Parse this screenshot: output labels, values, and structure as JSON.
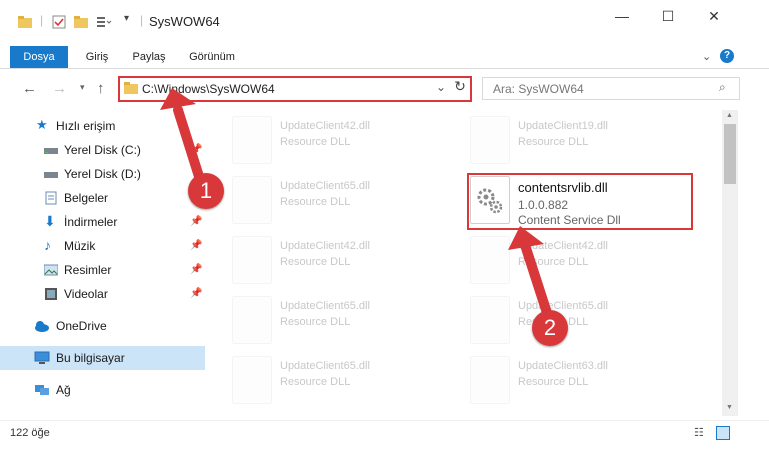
{
  "window": {
    "title": "SysWOW64",
    "minimize": "—",
    "maximize": "☐",
    "close": "✕"
  },
  "ribbon": {
    "tabs": [
      "Dosya",
      "Giriş",
      "Paylaş",
      "Görünüm"
    ],
    "help": "?"
  },
  "address": {
    "path": "C:\\Windows\\SysWOW64"
  },
  "search": {
    "placeholder": "Ara: SysWOW64"
  },
  "sidebar": {
    "quick_access": "Hızlı erişim",
    "items": [
      {
        "label": "Yerel Disk (C:)",
        "pinned": true,
        "icon": "drive-icon"
      },
      {
        "label": "Yerel Disk (D:)",
        "pinned": false,
        "icon": "drive-icon"
      },
      {
        "label": "Belgeler",
        "pinned": true,
        "icon": "documents-icon"
      },
      {
        "label": "İndirmeler",
        "pinned": true,
        "icon": "downloads-icon"
      },
      {
        "label": "Müzik",
        "pinned": true,
        "icon": "music-icon"
      },
      {
        "label": "Resimler",
        "pinned": true,
        "icon": "pictures-icon"
      },
      {
        "label": "Videolar",
        "pinned": true,
        "icon": "videos-icon"
      }
    ],
    "onedrive": "OneDrive",
    "this_pc": "Bu bilgisayar",
    "network": "Ağ"
  },
  "files": {
    "left_col": [
      {
        "name": "UpdateClient42.dll",
        "desc": "Resource DLL"
      },
      {
        "name": "UpdateClient65.dll",
        "desc": "Resource DLL"
      },
      {
        "name": "UpdateClient42.dll",
        "desc": "Resource DLL"
      },
      {
        "name": "UpdateClient65.dll",
        "desc": "Resource DLL"
      },
      {
        "name": "UpdateClient65.dll",
        "desc": "Resource DLL"
      }
    ],
    "right_col": [
      {
        "name": "UpdateClient19.dll",
        "desc": "Resource DLL"
      },
      {
        "name": "UpdateClient42.dll",
        "desc": "Resource DLL"
      },
      {
        "name": "UpdateClient65.dll",
        "desc": "Resource DLL"
      },
      {
        "name": "UpdateClient63.dll",
        "desc": "Resource DLL"
      }
    ],
    "featured": {
      "name": "contentsrvlib.dll",
      "version": "1.0.0.882",
      "desc": "Content Service Dll"
    }
  },
  "annotations": {
    "step1": "1",
    "step2": "2"
  },
  "status": {
    "count": "122 öğe"
  },
  "colors": {
    "accent": "#1979ca",
    "highlight": "#d8383a"
  }
}
